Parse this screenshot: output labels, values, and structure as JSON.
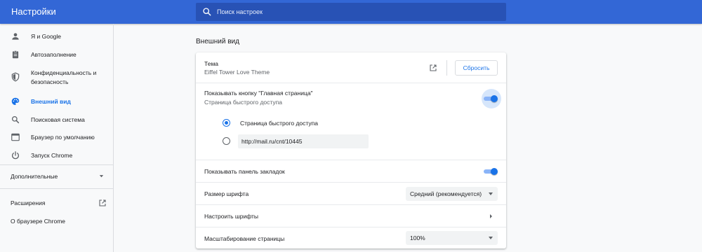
{
  "header": {
    "title": "Настройки",
    "search_placeholder": "Поиск настроек"
  },
  "sidebar": {
    "items": [
      {
        "label": "Я и Google",
        "icon": "person-icon"
      },
      {
        "label": "Автозаполнение",
        "icon": "clipboard-icon"
      },
      {
        "label": "Конфиденциальность и",
        "label2": "безопасность",
        "icon": "shield-icon"
      },
      {
        "label": "Внешний вид",
        "icon": "palette-icon",
        "active": true
      },
      {
        "label": "Поисковая система",
        "icon": "search-icon"
      },
      {
        "label": "Браузер по умолчанию",
        "icon": "browser-icon"
      },
      {
        "label": "Запуск Chrome",
        "icon": "power-icon"
      }
    ],
    "advanced_label": "Дополнительные",
    "extensions_label": "Расширения",
    "about_label": "О браузере Chrome"
  },
  "main": {
    "section_title": "Внешний вид",
    "theme": {
      "label": "Тема",
      "value": "Eiffel Tower Love Theme",
      "reset_label": "Сбросить"
    },
    "home_button": {
      "label": "Показывать кнопку \"Главная страница\"",
      "sublabel": "Страница быстрого доступа",
      "enabled": true,
      "options": [
        {
          "label": "Страница быстрого доступа",
          "checked": true
        },
        {
          "value": "http://mail.ru/cnt/10445",
          "checked": false
        }
      ]
    },
    "bookmarks_bar": {
      "label": "Показывать панель закладок",
      "enabled": true
    },
    "font_size": {
      "label": "Размер шрифта",
      "value": "Средний (рекомендуется)"
    },
    "customize_fonts": {
      "label": "Настроить шрифты"
    },
    "page_zoom": {
      "label": "Масштабирование страницы",
      "value": "100%"
    }
  },
  "colors": {
    "header_bg": "#3367d6",
    "accent": "#1a73e8",
    "page_bg": "#f8f9fa"
  }
}
